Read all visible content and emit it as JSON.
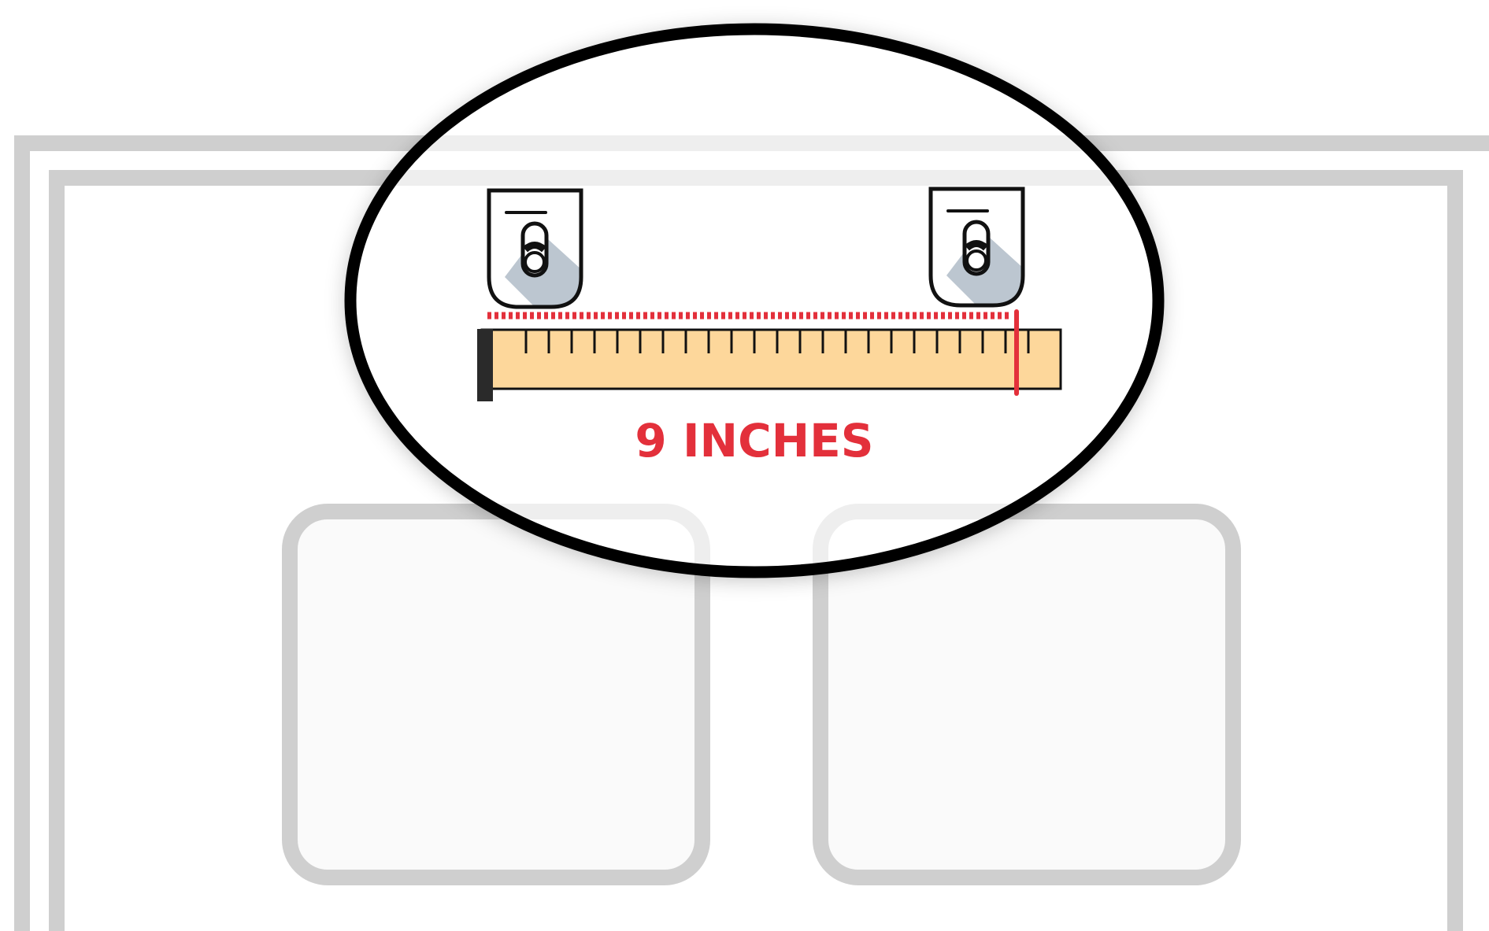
{
  "measurement": {
    "label": "9 INCHES",
    "value": 9,
    "unit": "inches"
  },
  "ruler": {
    "tick_count": 23
  },
  "colors": {
    "accent_red": "#e3303b",
    "ruler_fill": "#fdd79b",
    "outline_gray": "#cfcfcf",
    "ink": "#111111",
    "bracket_shadow": "#bcc6d0",
    "panel_fill": "#fafafa"
  },
  "icons": [
    "mounting-bracket-icon",
    "mounting-bracket-icon",
    "measuring-tape-icon"
  ]
}
